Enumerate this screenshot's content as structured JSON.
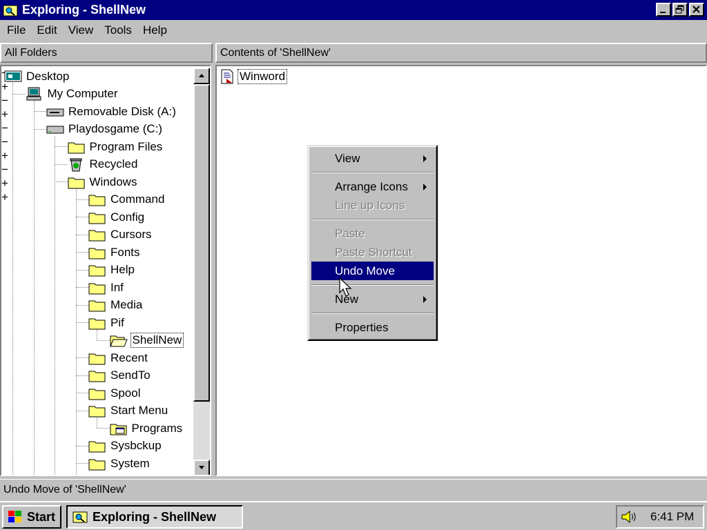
{
  "window": {
    "title": "Exploring - ShellNew"
  },
  "menubar": {
    "items": [
      "File",
      "Edit",
      "View",
      "Tools",
      "Help"
    ]
  },
  "left_pane": {
    "header": "All Folders"
  },
  "right_pane": {
    "header": "Contents of 'ShellNew'"
  },
  "tree": [
    {
      "label": "Desktop",
      "icon": "desktop-icon",
      "level": 0,
      "expander": ""
    },
    {
      "label": "My Computer",
      "icon": "computer-icon",
      "level": 1,
      "expander": "−"
    },
    {
      "label": "Removable Disk (A:)",
      "icon": "floppy-drive-icon",
      "level": 2,
      "expander": "+"
    },
    {
      "label": "Playdosgame (C:)",
      "icon": "hard-drive-icon",
      "level": 2,
      "expander": "−"
    },
    {
      "label": "Program Files",
      "icon": "folder-icon",
      "level": 3,
      "expander": "+"
    },
    {
      "label": "Recycled",
      "icon": "recycle-bin-icon",
      "level": 3,
      "expander": ""
    },
    {
      "label": "Windows",
      "icon": "folder-icon",
      "level": 3,
      "expander": "−"
    },
    {
      "label": "Command",
      "icon": "folder-icon",
      "level": 4,
      "expander": ""
    },
    {
      "label": "Config",
      "icon": "folder-icon",
      "level": 4,
      "expander": ""
    },
    {
      "label": "Cursors",
      "icon": "folder-icon",
      "level": 4,
      "expander": ""
    },
    {
      "label": "Fonts",
      "icon": "folder-icon",
      "level": 4,
      "expander": ""
    },
    {
      "label": "Help",
      "icon": "folder-icon",
      "level": 4,
      "expander": ""
    },
    {
      "label": "Inf",
      "icon": "folder-icon",
      "level": 4,
      "expander": ""
    },
    {
      "label": "Media",
      "icon": "folder-icon",
      "level": 4,
      "expander": ""
    },
    {
      "label": "Pif",
      "icon": "folder-icon",
      "level": 4,
      "expander": "−"
    },
    {
      "label": "ShellNew",
      "icon": "open-folder-icon",
      "level": 5,
      "expander": "",
      "selected": true
    },
    {
      "label": "Recent",
      "icon": "folder-icon",
      "level": 4,
      "expander": ""
    },
    {
      "label": "SendTo",
      "icon": "folder-icon",
      "level": 4,
      "expander": ""
    },
    {
      "label": "Spool",
      "icon": "folder-icon",
      "level": 4,
      "expander": "+"
    },
    {
      "label": "Start Menu",
      "icon": "folder-icon",
      "level": 4,
      "expander": "−"
    },
    {
      "label": "Programs",
      "icon": "programs-folder-icon",
      "level": 5,
      "expander": "+"
    },
    {
      "label": "Sysbckup",
      "icon": "folder-icon",
      "level": 4,
      "expander": ""
    },
    {
      "label": "System",
      "icon": "folder-icon",
      "level": 4,
      "expander": "+"
    }
  ],
  "files": [
    {
      "label": "Winword",
      "icon": "word-document-icon"
    }
  ],
  "context_menu": {
    "items": [
      {
        "label": "View",
        "submenu": true,
        "disabled": false,
        "highlight": false
      },
      {
        "separator": true
      },
      {
        "label": "Arrange Icons",
        "submenu": true,
        "disabled": false,
        "highlight": false
      },
      {
        "label": "Line up Icons",
        "submenu": false,
        "disabled": true,
        "highlight": false
      },
      {
        "separator": true
      },
      {
        "label": "Paste",
        "submenu": false,
        "disabled": true,
        "highlight": false
      },
      {
        "label": "Paste Shortcut",
        "submenu": false,
        "disabled": true,
        "highlight": false
      },
      {
        "label": "Undo Move",
        "submenu": false,
        "disabled": false,
        "highlight": true
      },
      {
        "separator": true
      },
      {
        "label": "New",
        "submenu": true,
        "disabled": false,
        "highlight": false
      },
      {
        "separator": true
      },
      {
        "label": "Properties",
        "submenu": false,
        "disabled": false,
        "highlight": false
      }
    ]
  },
  "statusbar": {
    "text": "Undo Move of 'ShellNew'"
  },
  "taskbar": {
    "start_label": "Start",
    "task_label": "Exploring - ShellNew",
    "clock": "6:41 PM"
  },
  "colors": {
    "title_bar": "#000080",
    "highlight": "#000080",
    "face": "#c0c0c0"
  }
}
